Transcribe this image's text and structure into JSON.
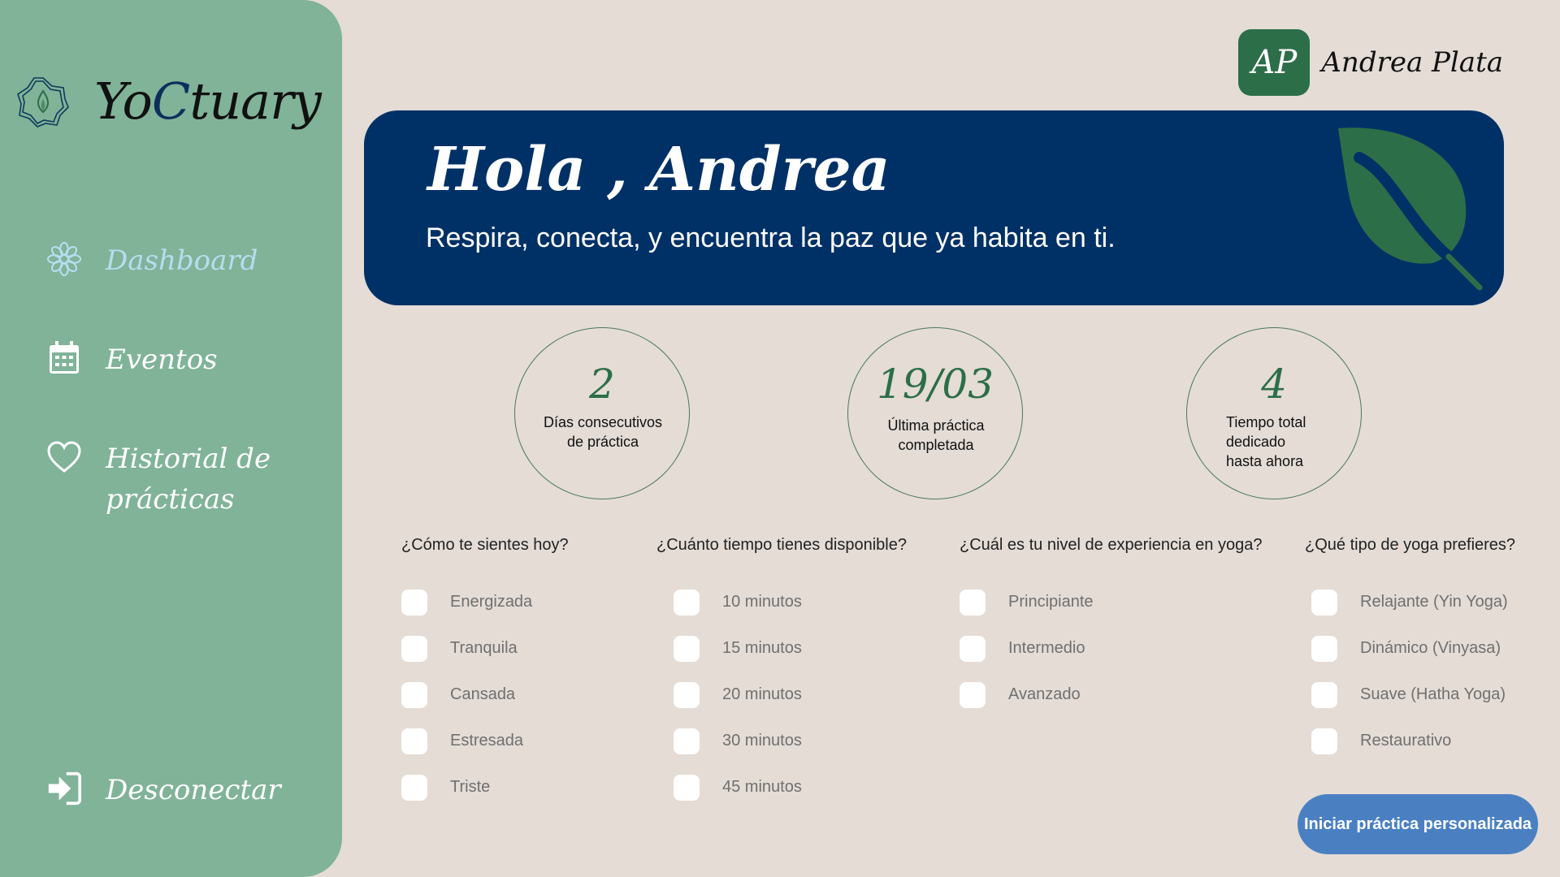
{
  "app": {
    "brand_prefix": "Yo",
    "brand_c": "C",
    "brand_suffix": "tuary"
  },
  "sidebar": {
    "items": [
      {
        "label": "Dashboard",
        "icon": "flower-icon",
        "active": true
      },
      {
        "label": "Eventos",
        "icon": "calendar-icon"
      },
      {
        "label": "Historial de prácticas",
        "icon": "heart-icon"
      }
    ],
    "logout_label": "Desconectar"
  },
  "user": {
    "initials": "AP",
    "name": "Andrea Plata"
  },
  "banner": {
    "title": "Hola , Andrea",
    "subtitle": "Respira, conecta, y encuentra la paz que ya habita en ti."
  },
  "stats": [
    {
      "value": "2",
      "label": "Días consecutivos de práctica"
    },
    {
      "value": "19/03",
      "label": "Última práctica completada"
    },
    {
      "value": "4",
      "label": "Tiempo total dedicado hasta ahora"
    }
  ],
  "questions": [
    {
      "question": "¿Cómo te sientes hoy?",
      "options": [
        "Energizada",
        "Tranquila",
        "Cansada",
        "Estresada",
        "Triste"
      ]
    },
    {
      "question": "¿Cuánto tiempo tienes disponible?",
      "options": [
        "10 minutos",
        "15 minutos",
        "20 minutos",
        "30 minutos",
        "45 minutos"
      ]
    },
    {
      "question": "¿Cuál es tu nivel de experiencia en yoga?",
      "options": [
        "Principiante",
        "Intermedio",
        "Avanzado"
      ]
    },
    {
      "question": "¿Qué tipo de yoga prefieres?",
      "options": [
        "Relajante (Yin Yoga)",
        "Dinámico (Vinyasa)",
        "Suave (Hatha Yoga)",
        "Restaurativo"
      ]
    }
  ],
  "cta_label": "Iniciar práctica personalizada",
  "colors": {
    "background": "#e4dcd5",
    "sidebar": "#80b398",
    "banner": "#003166",
    "accent_green": "#2c6e48",
    "button": "#4a80c2"
  }
}
